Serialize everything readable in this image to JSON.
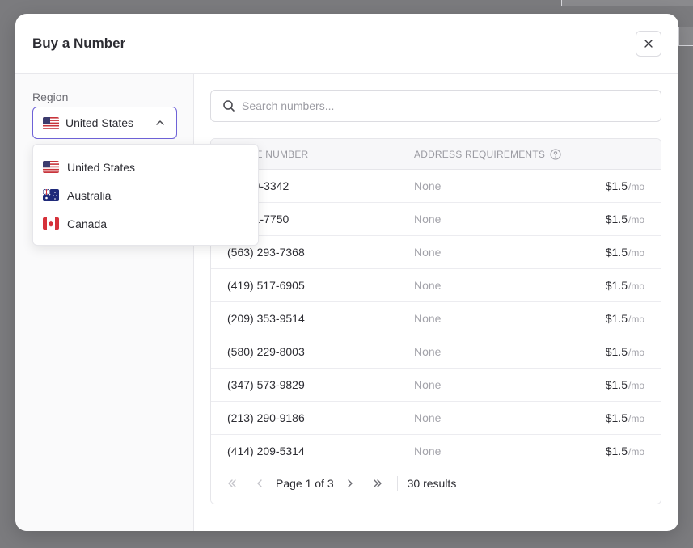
{
  "modal": {
    "title": "Buy a Number"
  },
  "sidebar": {
    "region_label": "Region",
    "selected_region": "United States",
    "options": [
      {
        "label": "United States",
        "flag": "us-flag-icon"
      },
      {
        "label": "Australia",
        "flag": "au-flag-icon"
      },
      {
        "label": "Canada",
        "flag": "ca-flag-icon"
      }
    ]
  },
  "search": {
    "placeholder": "Search numbers...",
    "value": ""
  },
  "table": {
    "columns": [
      "PHONE NUMBER",
      "ADDRESS REQUIREMENTS",
      ""
    ],
    "rows": [
      {
        "number": "(   ) 309-3342",
        "address": "None",
        "price": "$1.5",
        "per": "/mo"
      },
      {
        "number": "(   ) 491-7750",
        "address": "None",
        "price": "$1.5",
        "per": "/mo"
      },
      {
        "number": "(563) 293-7368",
        "address": "None",
        "price": "$1.5",
        "per": "/mo"
      },
      {
        "number": "(419) 517-6905",
        "address": "None",
        "price": "$1.5",
        "per": "/mo"
      },
      {
        "number": "(209) 353-9514",
        "address": "None",
        "price": "$1.5",
        "per": "/mo"
      },
      {
        "number": "(580) 229-8003",
        "address": "None",
        "price": "$1.5",
        "per": "/mo"
      },
      {
        "number": "(347) 573-9829",
        "address": "None",
        "price": "$1.5",
        "per": "/mo"
      },
      {
        "number": "(213) 290-9186",
        "address": "None",
        "price": "$1.5",
        "per": "/mo"
      },
      {
        "number": "(414) 209-5314",
        "address": "None",
        "price": "$1.5",
        "per": "/mo"
      }
    ]
  },
  "pagination": {
    "page_text": "Page 1 of 3",
    "results_text": "30 results"
  },
  "colors": {
    "accent": "#6e62d7",
    "backdrop": "#7b7b7e"
  }
}
